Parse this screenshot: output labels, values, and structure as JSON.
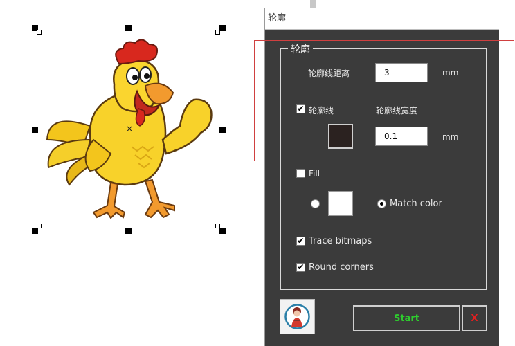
{
  "dialog": {
    "title": "轮廓",
    "group_title": "轮廓",
    "outline_distance": {
      "label": "轮廓线距离",
      "value": "3",
      "unit": "mm"
    },
    "outline_line": {
      "label": "轮廓线",
      "checked": true,
      "color": "#2b2220"
    },
    "outline_width": {
      "label": "轮廓线宽度",
      "value": "0.1",
      "unit": "mm"
    },
    "fill": {
      "label": "Fill",
      "checked": false,
      "color": "#ffffff"
    },
    "match_color": {
      "label": "Match color",
      "selected": true
    },
    "trace_bitmaps": {
      "label": "Trace bitmaps",
      "checked": true
    },
    "round_corners": {
      "label": "Round corners",
      "checked": true
    },
    "start_label": "Start",
    "close_label": "X",
    "check_mark": "✔"
  },
  "colors": {
    "panel_bg": "#3b3b3b",
    "start_text": "#2ecc2e",
    "close_text": "#e02020",
    "highlight": "#d04040"
  }
}
